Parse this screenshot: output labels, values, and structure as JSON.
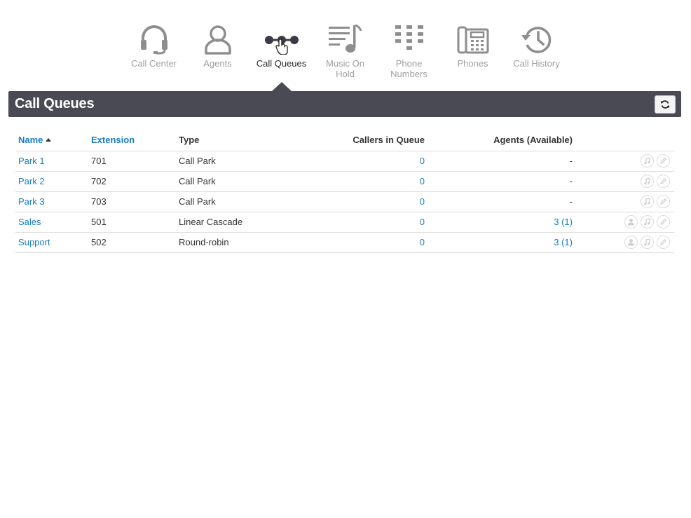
{
  "nav": {
    "items": [
      {
        "label": "Call Center",
        "icon": "headset-icon"
      },
      {
        "label": "Agents",
        "icon": "agent-person-icon"
      },
      {
        "label": "Call Queues",
        "icon": "call-queues-icon"
      },
      {
        "label": "Music On Hold",
        "icon": "music-list-icon"
      },
      {
        "label": "Phone Numbers",
        "icon": "keypad-grid-icon"
      },
      {
        "label": "Phones",
        "icon": "desk-phone-icon"
      },
      {
        "label": "Call History",
        "icon": "history-clock-icon"
      }
    ],
    "active": "Call Queues"
  },
  "page": {
    "title": "Call Queues",
    "refresh_icon": "refresh-icon"
  },
  "table": {
    "headers": {
      "name": "Name",
      "extension": "Extension",
      "type": "Type",
      "callers": "Callers in Queue",
      "agents": "Agents (Available)"
    },
    "sort": {
      "column": "Name",
      "direction": "ascending"
    },
    "rows": [
      {
        "name": "Park 1",
        "extension": "701",
        "type": "Call Park",
        "callers": "0",
        "agents": "-"
      },
      {
        "name": "Park 2",
        "extension": "702",
        "type": "Call Park",
        "callers": "0",
        "agents": "-"
      },
      {
        "name": "Park 3",
        "extension": "703",
        "type": "Call Park",
        "callers": "0",
        "agents": "-"
      },
      {
        "name": "Sales",
        "extension": "501",
        "type": "Linear Cascade",
        "callers": "0",
        "agents": "3 (1)"
      },
      {
        "name": "Support",
        "extension": "502",
        "type": "Round-robin",
        "callers": "0",
        "agents": "3 (1)"
      }
    ]
  },
  "colors": {
    "link": "#1a7cbf",
    "header_bar": "#4a4a54",
    "nav_inactive": "#a0a0a0",
    "nav_active": "#2b2b2b"
  }
}
